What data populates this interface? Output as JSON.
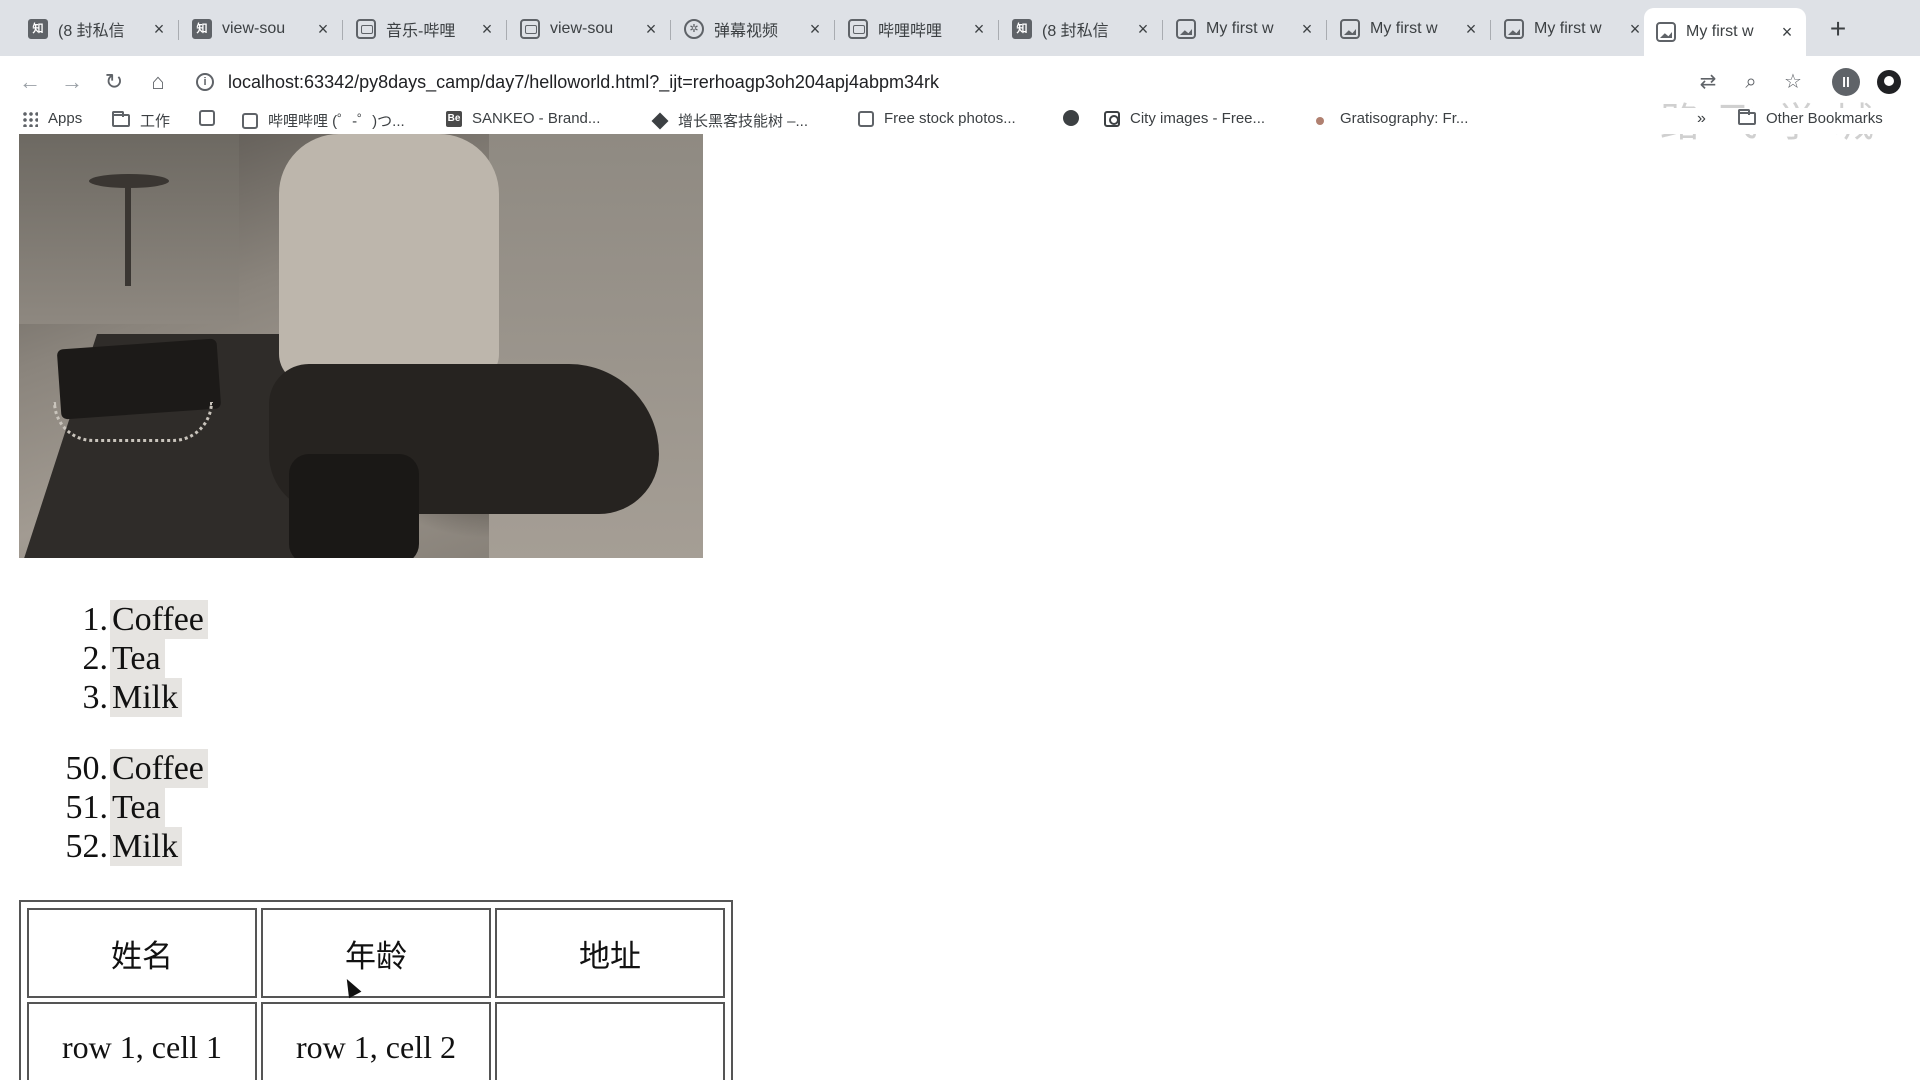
{
  "tabs": [
    {
      "title": "(8 封私信",
      "icon": "zhihu-icon",
      "active": false
    },
    {
      "title": "view-sou",
      "icon": "zhihu-icon",
      "active": false
    },
    {
      "title": "音乐-哔哩",
      "icon": "bilibili-icon",
      "active": false
    },
    {
      "title": "view-sou",
      "icon": "bilibili-icon",
      "active": false
    },
    {
      "title": "弹幕视频",
      "icon": "paw-icon",
      "active": false
    },
    {
      "title": "哔哩哔哩",
      "icon": "bilibili-icon",
      "active": false
    },
    {
      "title": "(8 封私信",
      "icon": "zhihu-icon",
      "active": false
    },
    {
      "title": "My first w",
      "icon": "image-icon",
      "active": false
    },
    {
      "title": "My first w",
      "icon": "image-icon",
      "active": false
    },
    {
      "title": "My first w",
      "icon": "image-icon",
      "active": false
    },
    {
      "title": "My first w",
      "icon": "image-icon",
      "active": true
    }
  ],
  "toolbar": {
    "url": "localhost:63342/py8days_camp/day7/helloworld.html?_ijt=rerhoagp3oh204apj4abpm34rk",
    "avatar_letter": "ll",
    "watermark": "路飞学城"
  },
  "bookmarks": [
    {
      "label": "Apps",
      "icon": "apps-grid-icon"
    },
    {
      "label": "工作",
      "icon": "folder-icon"
    },
    {
      "label": "",
      "icon": "bookmark-box-icon"
    },
    {
      "label": "哔哩哔哩 (゜-゜)つ...",
      "icon": "bilibili-icon"
    },
    {
      "label": "SANKEO - Brand...",
      "icon": "behance-icon"
    },
    {
      "label": "增长黑客技能树 –...",
      "icon": "cube-icon"
    },
    {
      "label": "Free stock photos...",
      "icon": "pexels-icon"
    },
    {
      "label": "",
      "icon": "globe-icon"
    },
    {
      "label": "City images - Free...",
      "icon": "camera-icon"
    },
    {
      "label": "Gratisography: Fr...",
      "icon": "dot-icon"
    }
  ],
  "bookmarks_overflow": "»",
  "other_bookmarks": "Other Bookmarks",
  "list1": [
    {
      "num": "1.",
      "text": "Coffee"
    },
    {
      "num": "2.",
      "text": "Tea"
    },
    {
      "num": "3.",
      "text": "Milk"
    }
  ],
  "list2": [
    {
      "num": "50.",
      "text": "Coffee"
    },
    {
      "num": "51.",
      "text": "Tea"
    },
    {
      "num": "52.",
      "text": "Milk"
    }
  ],
  "table": {
    "headers": [
      "姓名",
      "年龄",
      "地址"
    ],
    "rows": [
      [
        "row 1, cell 1",
        "row 1, cell 2",
        ""
      ]
    ]
  },
  "colors": {
    "tabstrip_bg": "#dee1e6",
    "list_highlight": "#e6e4e1"
  }
}
